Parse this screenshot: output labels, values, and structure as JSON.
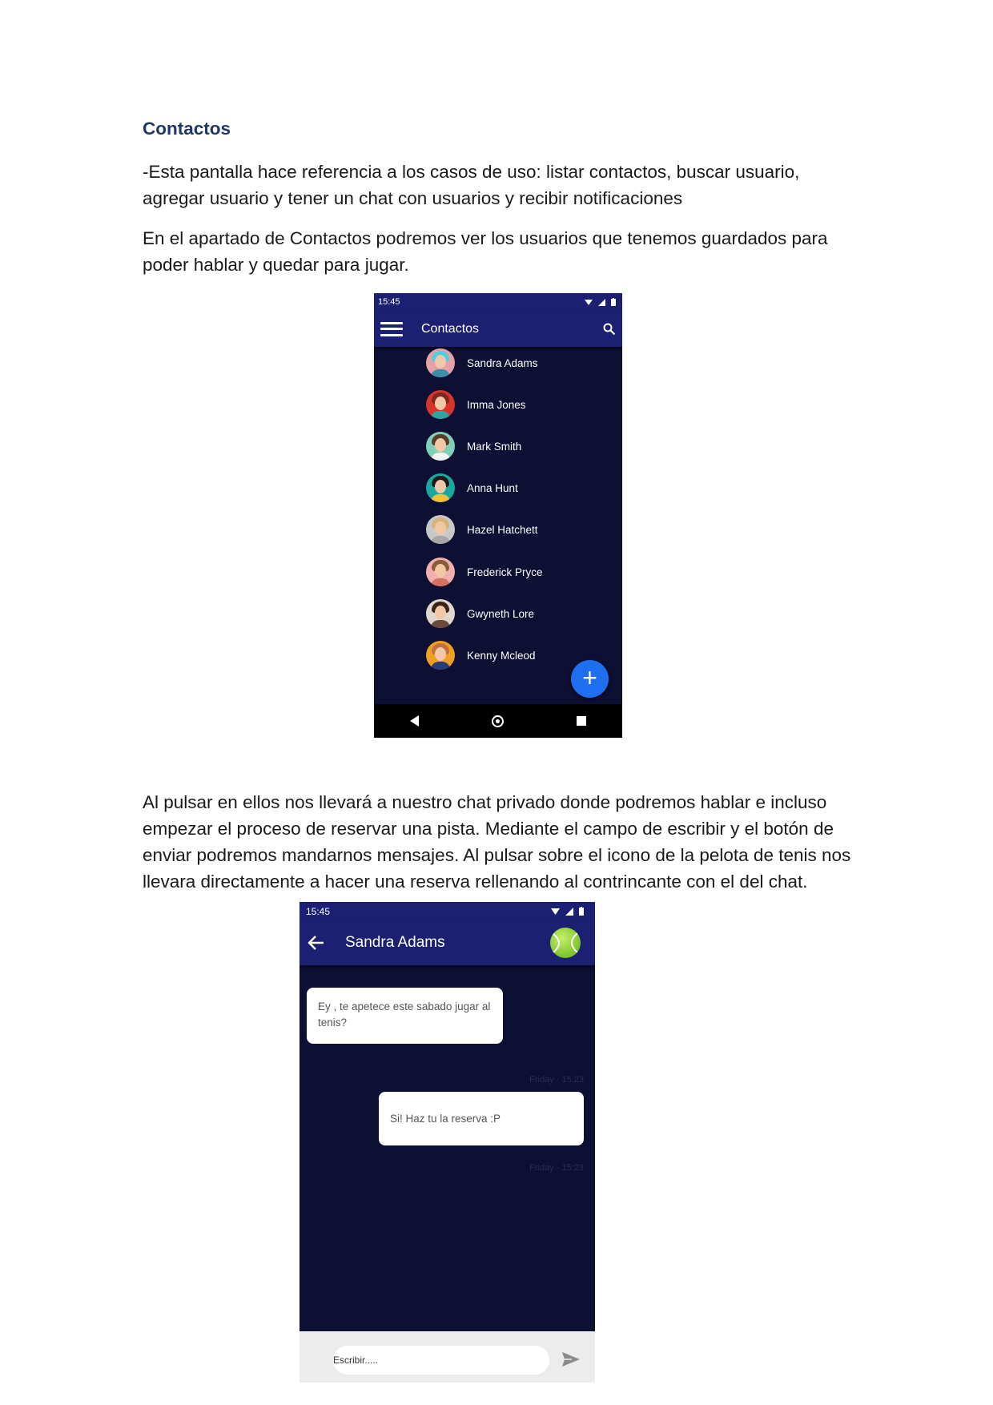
{
  "document": {
    "heading": "Contactos",
    "paragraph1": "-Esta pantalla hace referencia a los casos de uso: listar contactos, buscar usuario, agregar usuario y tener un chat con usuarios y recibir notificaciones",
    "paragraph2": "En el apartado de Contactos podremos ver los usuarios que tenemos guardados para poder hablar y quedar para jugar.",
    "paragraph3": "Al pulsar en ellos nos llevará a nuestro chat privado donde podremos hablar e incluso empezar el proceso de reservar una pista. Mediante el campo de escribir y el botón de enviar podremos mandarnos mensajes. Al pulsar sobre el icono de la pelota de tenis nos llevara directamente a hacer una reserva rellenando al contrincante con el del chat."
  },
  "contacts_screen": {
    "status_time": "15:45",
    "title": "Contactos",
    "search_icon": "search-icon",
    "menu_icon": "menu-icon",
    "fab_label": "+",
    "contacts": [
      {
        "name": "Sandra Adams",
        "avatar_bg": "#e8a0a8",
        "hair": "#4fd0e0",
        "shirt": "#3c8fa8"
      },
      {
        "name": "Imma Jones",
        "avatar_bg": "#d8342f",
        "hair": "#7a2a1a",
        "shirt": "#2ba7a0"
      },
      {
        "name": "Mark Smith",
        "avatar_bg": "#7fd0b8",
        "hair": "#5a3a28",
        "shirt": "#f2f2f2"
      },
      {
        "name": "Anna Hunt",
        "avatar_bg": "#1aa7a0",
        "hair": "#1a1a1a",
        "shirt": "#f0c23a"
      },
      {
        "name": "Hazel Hatchett",
        "avatar_bg": "#c8c8c8",
        "hair": "#d8b27a",
        "shirt": "#a7a7a7"
      },
      {
        "name": "Frederick Pryce",
        "avatar_bg": "#f0b0b0",
        "hair": "#8a5a3a",
        "shirt": "#d87060"
      },
      {
        "name": "Gwyneth Lore",
        "avatar_bg": "#e0d8d0",
        "hair": "#3a2418",
        "shirt": "#6a4a38"
      },
      {
        "name": "Kenny Mcleod",
        "avatar_bg": "#f0a020",
        "hair": "#c07040",
        "shirt": "#2a3a7a"
      }
    ]
  },
  "chat_screen": {
    "status_time": "15:45",
    "title": "Sandra Adams",
    "messages": [
      {
        "text": "Ey , te apetece este sabado jugar al tenis?",
        "direction": "incoming",
        "time": "Friday · 15:23"
      },
      {
        "text": "Si! Haz tu la reserva :P",
        "direction": "outgoing",
        "time": "Friday · 15:23"
      }
    ],
    "input_placeholder": "Escribir.....",
    "send_icon": "send-icon",
    "tennis_icon": "tennis-ball-icon"
  }
}
